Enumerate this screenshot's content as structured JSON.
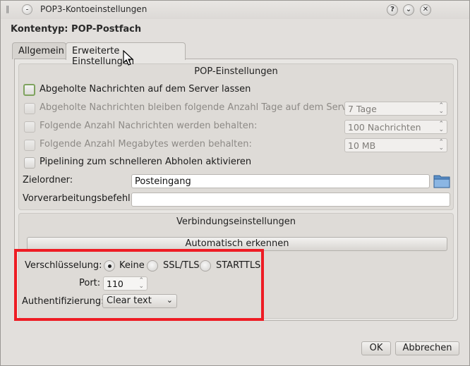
{
  "window": {
    "title": "POP3-Kontoeinstellungen",
    "buttons": [
      "?",
      "⌄",
      "✕"
    ]
  },
  "account_type": "Kontentyp: POP-Postfach",
  "tabs": [
    {
      "label": "Allgemein",
      "active": false
    },
    {
      "label": "Erweiterte Einstellungen",
      "active": true
    }
  ],
  "pop_settings": {
    "title": "POP-Einstellungen",
    "leave_on_server": {
      "label": "Abgeholte Nachrichten auf dem Server lassen",
      "checked": false
    },
    "keep_days": {
      "label": "Abgeholte Nachrichten bleiben folgende Anzahl Tage auf dem Server",
      "value": "7 Tage"
    },
    "keep_count": {
      "label": "Folgende Anzahl Nachrichten werden behalten:",
      "value": "100 Nachrichten"
    },
    "keep_mb": {
      "label": "Folgende Anzahl Megabytes werden behalten:",
      "value": "10 MB"
    },
    "pipelining": {
      "label": "Pipelining zum schnelleren Abholen aktivieren",
      "checked": false
    },
    "target_folder": {
      "label": "Zielordner:",
      "value": "Posteingang"
    },
    "preprocess": {
      "label": "Vorverarbeitungsbefehl:",
      "value": ""
    }
  },
  "connection": {
    "title": "Verbindungseinstellungen",
    "auto_detect": "Automatisch erkennen",
    "encryption_label": "Verschlüsselung:",
    "encryption_options": [
      "Keine",
      "SSL/TLS",
      "STARTTLS"
    ],
    "encryption_selected": "Keine",
    "port_label": "Port:",
    "port_value": "110",
    "auth_label": "Authentifizierung:",
    "auth_value": "Clear text"
  },
  "footer": {
    "ok": "OK",
    "cancel": "Abbrechen"
  },
  "colors": {
    "highlight": "#ee1c24",
    "focus": "#7fa35f"
  }
}
